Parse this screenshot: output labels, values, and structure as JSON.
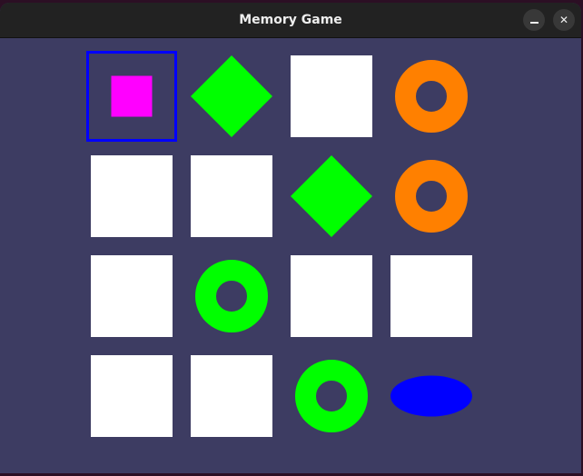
{
  "window": {
    "title": "Memory Game",
    "minimize_icon": "minimize-icon",
    "close_icon": "close-icon"
  },
  "colors": {
    "board_bg": "#3d3c62",
    "card_back": "#ffffff",
    "selection": "#0000ff"
  },
  "board": {
    "rows": 4,
    "cols": 4,
    "selected": {
      "row": 0,
      "col": 0
    },
    "cards": [
      [
        {
          "state": "revealed",
          "shape": "square",
          "color": "#ff00ff"
        },
        {
          "state": "revealed",
          "shape": "diamond",
          "color": "#00ff00"
        },
        {
          "state": "hidden"
        },
        {
          "state": "revealed",
          "shape": "ring",
          "color": "#ff8000"
        }
      ],
      [
        {
          "state": "hidden"
        },
        {
          "state": "hidden"
        },
        {
          "state": "revealed",
          "shape": "diamond",
          "color": "#00ff00"
        },
        {
          "state": "revealed",
          "shape": "ring",
          "color": "#ff8000"
        }
      ],
      [
        {
          "state": "hidden"
        },
        {
          "state": "revealed",
          "shape": "ring",
          "color": "#00ff00"
        },
        {
          "state": "hidden"
        },
        {
          "state": "hidden"
        }
      ],
      [
        {
          "state": "hidden"
        },
        {
          "state": "hidden"
        },
        {
          "state": "revealed",
          "shape": "ring",
          "color": "#00ff00"
        },
        {
          "state": "revealed",
          "shape": "oval",
          "color": "#0000ff"
        }
      ]
    ]
  }
}
